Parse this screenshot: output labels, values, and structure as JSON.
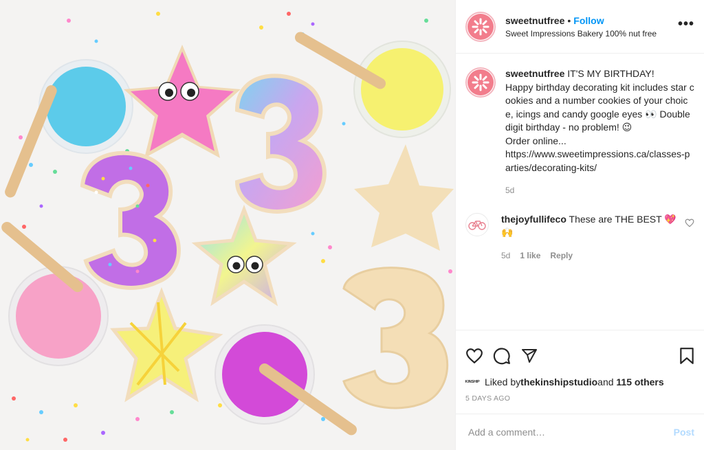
{
  "post": {
    "username": "sweetnutfree",
    "separator": "•",
    "follow_label": "Follow",
    "location": "Sweet Impressions Bakery 100% nut free",
    "more_label": "•••"
  },
  "caption": {
    "username": "sweetnutfree",
    "text": " IT'S MY BIRTHDAY!\nHappy birthday decorating kit includes star cookies and a number cookies of your choice, icings and candy google eyes 👀 Double digit birthday - no problem! 😉\nOrder online...\nhttps://www.sweetimpressions.ca/classes-parties/decorating-kits/",
    "time": "5d"
  },
  "comment": {
    "username": "thejoyfullifeco",
    "text": " These are THE BEST 💖🙌",
    "time": "5d",
    "likes": "1 like",
    "reply_label": "Reply"
  },
  "likes": {
    "avatar_text": "KINSHIP",
    "prefix": "Liked by ",
    "user": "thekinshipstudio",
    "middle": " and ",
    "others": "115 others"
  },
  "date_label": "5 DAYS AGO",
  "add_comment": {
    "placeholder": "Add a comment…",
    "post_label": "Post"
  },
  "colors": {
    "follow": "#0095f6",
    "brand_pink": "#f27d8c",
    "muted": "#8e8e8e",
    "post_disabled": "#b3dbff"
  },
  "icons": [
    "sparkle-logo-icon",
    "more-icon",
    "bicycle-icon",
    "heart-outline-icon",
    "comment-icon",
    "share-icon",
    "bookmark-icon"
  ]
}
